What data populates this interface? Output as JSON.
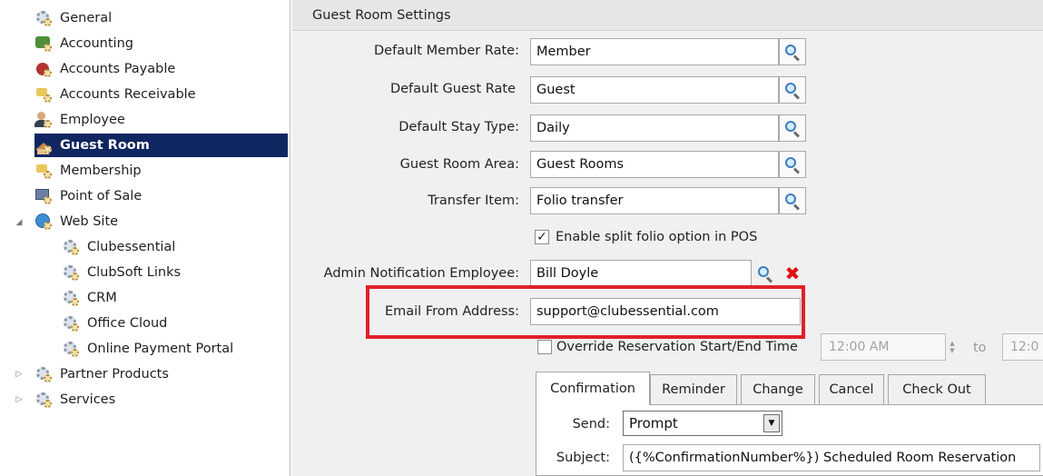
{
  "sidebar": {
    "items": [
      {
        "label": "General",
        "icon": "gear-icon"
      },
      {
        "label": "Accounting",
        "icon": "accounting-icon"
      },
      {
        "label": "Accounts Payable",
        "icon": "accounts-payable-icon"
      },
      {
        "label": "Accounts Receivable",
        "icon": "accounts-receivable-icon"
      },
      {
        "label": "Employee",
        "icon": "employee-icon"
      },
      {
        "label": "Guest Room",
        "icon": "guest-room-icon",
        "selected": true
      },
      {
        "label": "Membership",
        "icon": "membership-icon"
      },
      {
        "label": "Point of Sale",
        "icon": "point-of-sale-icon"
      },
      {
        "label": "Web Site",
        "icon": "web-site-icon",
        "expanded": true
      },
      {
        "label": "Clubessential",
        "icon": "gear-icon"
      },
      {
        "label": "ClubSoft Links",
        "icon": "gear-icon"
      },
      {
        "label": "CRM",
        "icon": "gear-icon"
      },
      {
        "label": "Office Cloud",
        "icon": "gear-icon"
      },
      {
        "label": "Online Payment Portal",
        "icon": "gear-icon"
      },
      {
        "label": "Partner Products",
        "icon": "gear-icon",
        "collapsed": true
      },
      {
        "label": "Services",
        "icon": "gear-icon",
        "collapsed": true
      }
    ],
    "selected_color": "#0f2660"
  },
  "main": {
    "title": "Guest Room Settings",
    "fields": {
      "default_member_rate": {
        "label": "Default Member Rate:",
        "value": "Member"
      },
      "default_guest_rate": {
        "label": "Default Guest Rate",
        "value": "Guest"
      },
      "default_stay_type": {
        "label": "Default Stay Type:",
        "value": "Daily"
      },
      "guest_room_area": {
        "label": "Guest Room Area:",
        "value": "Guest Rooms"
      },
      "transfer_item": {
        "label": "Transfer Item:",
        "value": "Folio transfer"
      },
      "admin_notification_employee": {
        "label": "Admin Notification Employee:",
        "value": "Bill Doyle"
      },
      "email_from_address": {
        "label": "Email From Address:",
        "value": "support@clubessential.com"
      }
    },
    "split_folio": {
      "label": "Enable split folio option in POS",
      "checked": true
    },
    "override_reservation": {
      "label": "Override Reservation Start/End Time",
      "checked": false,
      "start_time": "12:00 AM",
      "to_label": "to",
      "end_time": "12:0"
    },
    "tabs": [
      {
        "label": "Confirmation",
        "active": true
      },
      {
        "label": "Reminder"
      },
      {
        "label": "Change"
      },
      {
        "label": "Cancel"
      },
      {
        "label": "Check Out"
      }
    ],
    "confirmation": {
      "send_label": "Send:",
      "send_value": "Prompt",
      "subject_label": "Subject:",
      "subject_value": "({%ConfirmationNumber%}) Scheduled Room Reservation"
    },
    "highlight_color": "#e0202a"
  }
}
